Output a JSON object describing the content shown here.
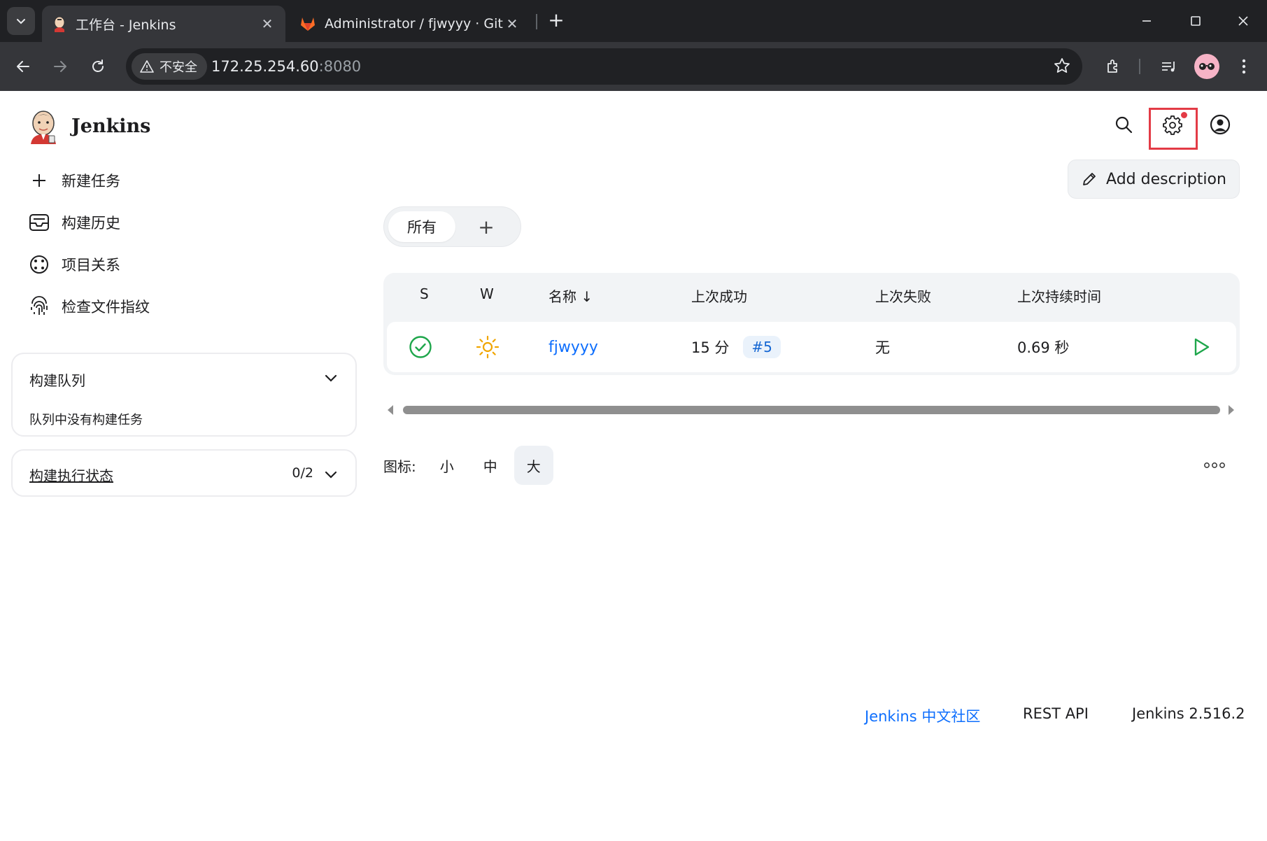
{
  "browser": {
    "tabs": [
      {
        "title": "工作台 - Jenkins",
        "active": true
      },
      {
        "title": "Administrator / fjwyyy · GitLa",
        "active": false
      }
    ],
    "close_glyph": "✕",
    "new_tab_glyph": "+",
    "address": {
      "security_label": "不安全",
      "host": "172.25.254.60",
      "port": ":8080"
    }
  },
  "header": {
    "app_name": "Jenkins"
  },
  "sidebar": {
    "tasks": [
      {
        "label": "新建任务",
        "icon": "plus-icon"
      },
      {
        "label": "构建历史",
        "icon": "inbox-icon"
      },
      {
        "label": "项目关系",
        "icon": "relationship-icon"
      },
      {
        "label": "检查文件指纹",
        "icon": "fingerprint-icon"
      }
    ],
    "build_queue": {
      "title": "构建队列",
      "empty_text": "队列中没有构建任务"
    },
    "executors": {
      "title": "构建执行状态",
      "count": "0/2"
    }
  },
  "main": {
    "add_description_label": "Add description",
    "views": {
      "active_tab": "所有",
      "add_glyph": "+"
    },
    "table": {
      "columns": {
        "status": "S",
        "weather": "W",
        "name": "名称",
        "name_sort_glyph": "↓",
        "last_success": "上次成功",
        "last_failure": "上次失败",
        "last_duration": "上次持续时间"
      },
      "rows": [
        {
          "status": "success",
          "weather": "sunny",
          "name": "fjwyyy",
          "last_success": "15 分",
          "last_success_build": "#5",
          "last_failure": "无",
          "last_duration": "0.69 秒"
        }
      ]
    },
    "icon_size": {
      "label": "图标:",
      "options": [
        "小",
        "中",
        "大"
      ],
      "selected": "大"
    }
  },
  "footer": {
    "community_link": "Jenkins 中文社区",
    "rest_api": "REST API",
    "version": "Jenkins 2.516.2"
  },
  "colors": {
    "accent_link": "#0d6efd",
    "success": "#1ea64b",
    "sunny": "#f0a500",
    "highlight_box": "#e33b46"
  }
}
